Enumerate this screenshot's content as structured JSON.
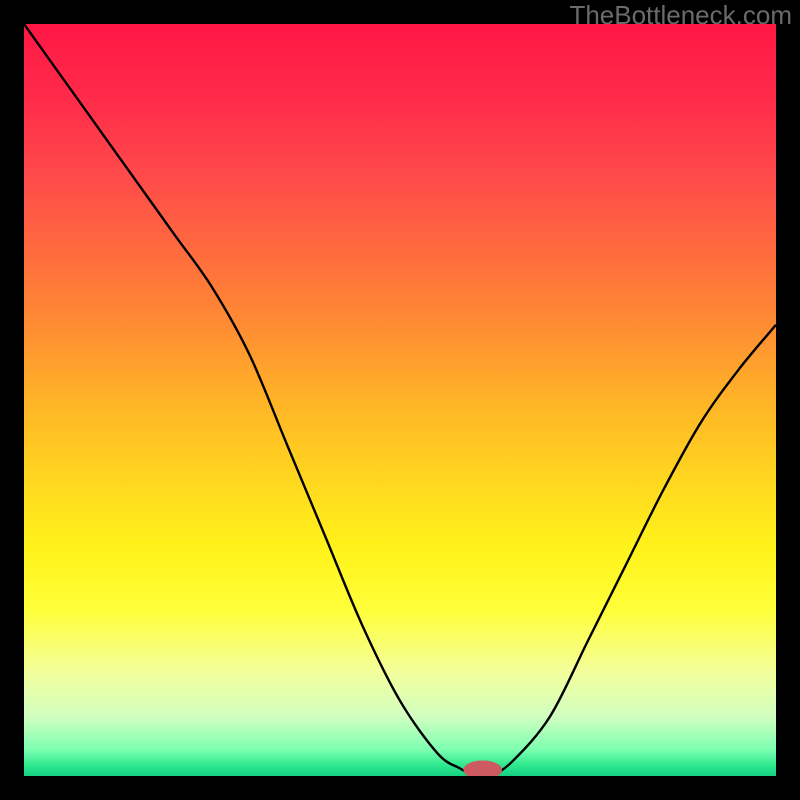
{
  "watermark": "TheBottleneck.com",
  "colors": {
    "gradient_stops": [
      {
        "offset": 0.0,
        "color": "#ff1744"
      },
      {
        "offset": 0.1,
        "color": "#ff2b4a"
      },
      {
        "offset": 0.2,
        "color": "#ff4a4a"
      },
      {
        "offset": 0.3,
        "color": "#ff6a3e"
      },
      {
        "offset": 0.4,
        "color": "#ff8c33"
      },
      {
        "offset": 0.5,
        "color": "#ffb327"
      },
      {
        "offset": 0.6,
        "color": "#ffd51f"
      },
      {
        "offset": 0.7,
        "color": "#fff31a"
      },
      {
        "offset": 0.78,
        "color": "#ffff3a"
      },
      {
        "offset": 0.86,
        "color": "#f3ff9a"
      },
      {
        "offset": 0.92,
        "color": "#d2ffc0"
      },
      {
        "offset": 0.965,
        "color": "#7dffb0"
      },
      {
        "offset": 0.985,
        "color": "#30e98f"
      },
      {
        "offset": 1.0,
        "color": "#14d184"
      }
    ],
    "curve": "#000000",
    "marker_fill": "#cc5a5f",
    "marker_stroke": "#cc5a5f",
    "frame": "#000000"
  },
  "chart_data": {
    "type": "line",
    "title": "",
    "xlabel": "",
    "ylabel": "",
    "xlim": [
      0,
      100
    ],
    "ylim": [
      0,
      100
    ],
    "x": [
      0,
      5,
      10,
      15,
      20,
      25,
      30,
      35,
      40,
      45,
      50,
      55,
      58,
      60,
      62,
      65,
      70,
      75,
      80,
      85,
      90,
      95,
      100
    ],
    "values": [
      100,
      93,
      86,
      79,
      72,
      65,
      56,
      44,
      32,
      20,
      10,
      3,
      1,
      0,
      0,
      2,
      8,
      18,
      28,
      38,
      47,
      54,
      60
    ],
    "marker": {
      "x": 61,
      "y": 0,
      "rx": 2.5,
      "ry": 1.2
    },
    "notes": "Bottleneck-style curve: steep descent from top-left, minimum near x≈60, rising toward right. Background is a vertical red→yellow→green gradient indicating bottleneck severity."
  }
}
